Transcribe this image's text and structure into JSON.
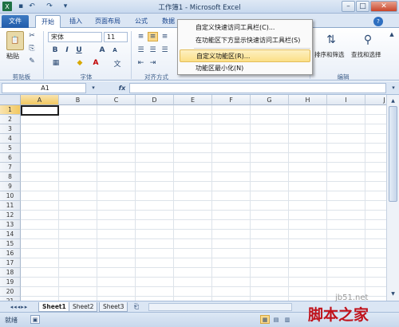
{
  "window": {
    "title": "工作簿1 - Microsoft Excel",
    "minimize_glyph": "–",
    "maximize_glyph": "□",
    "close_glyph": "✕"
  },
  "quick_access": {
    "undo_glyph": "↶",
    "redo_glyph": "↷",
    "more_glyph": "▾"
  },
  "tabs": [
    {
      "label": "文件"
    },
    {
      "label": "开始"
    },
    {
      "label": "插入"
    },
    {
      "label": "页面布局"
    },
    {
      "label": "公式"
    },
    {
      "label": "数据"
    }
  ],
  "ribbon": {
    "paste_label": "粘贴",
    "clipboard_label": "剪贴板",
    "font_name": "宋体",
    "font_size": "11",
    "font_group_label": "字体",
    "align_group_label": "对齐方式",
    "bold": "B",
    "italic": "I",
    "underline": "U",
    "font_color": "A",
    "grow_font": "A",
    "shrink_font": "A",
    "sort_filter_label": "排序和筛选",
    "find_select_label": "查找和选择",
    "edit_group_label": "编辑"
  },
  "context_menu": {
    "items": [
      {
        "label": "自定义快速访问工具栏(C)..."
      },
      {
        "label": "在功能区下方显示快速访问工具栏(S)"
      },
      {
        "label": "自定义功能区(R)..."
      },
      {
        "label": "功能区最小化(N)"
      }
    ],
    "highlighted_index": 2
  },
  "formula_bar": {
    "name_box": "A1",
    "fx": "fx",
    "value": ""
  },
  "grid": {
    "columns": [
      "A",
      "B",
      "C",
      "D",
      "E",
      "F",
      "G",
      "H",
      "I",
      "J"
    ],
    "rows": [
      "1",
      "2",
      "3",
      "4",
      "5",
      "6",
      "7",
      "8",
      "9",
      "10",
      "11",
      "12",
      "13",
      "14",
      "15",
      "16",
      "17",
      "18",
      "19",
      "20",
      "21"
    ],
    "selected_cell": "A1"
  },
  "sheets": [
    {
      "label": "Sheet1"
    },
    {
      "label": "Sheet2"
    },
    {
      "label": "Sheet3"
    }
  ],
  "status_bar": {
    "ready": "就绪"
  },
  "watermark": {
    "text": "脚本之家",
    "url": "jb51.net"
  },
  "colors": {
    "file_tab": "#2a62ad",
    "menu_highlight": "#fbdf86",
    "selection_border": "#217346",
    "watermark": "#c0121b"
  }
}
